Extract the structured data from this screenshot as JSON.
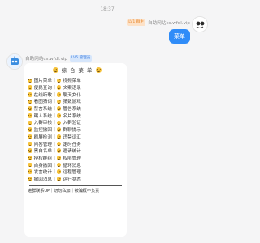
{
  "timestamp": "18:37",
  "outgoing": {
    "level_badge": "LV1 群主",
    "sender_name": "自助网站cs.wfdl.vip",
    "message": "菜单"
  },
  "incoming": {
    "sender_name": "自助网站cs.wfdl.vip",
    "badge": "LV5 管理员",
    "menu_title": "综 合 菜 单",
    "rows": [
      {
        "left": "图片菜单",
        "right": "视频菜单"
      },
      {
        "left": "便民查询",
        "right": "文案语录"
      },
      {
        "left": "在线听歌",
        "right": "聊天女仆"
      },
      {
        "left": "看图猜词",
        "right": "猜数游戏"
      },
      {
        "left": "禁言系统",
        "right": "管告系统"
      },
      {
        "left": "踢人系统",
        "right": "名片系统"
      },
      {
        "left": "入群审核",
        "right": "入群验证"
      },
      {
        "left": "监控撤回",
        "right": "群聊提示"
      },
      {
        "left": "刷屏检测",
        "right": "违禁词汇"
      },
      {
        "left": "问答管理",
        "right": "定时任务"
      },
      {
        "left": "黑白名单",
        "right": "邀请统计"
      },
      {
        "left": "授权群组",
        "right": "权限管理"
      },
      {
        "left": "自身撤回",
        "right": "循环消息"
      },
      {
        "left": "发言统计",
        "right": "远程管理"
      },
      {
        "left": "撤回消息",
        "right": "运行状态"
      }
    ],
    "footer": "进群联系UP｜切勿私加｜被骗概不负责"
  },
  "colors": {
    "bubble_out": "#2f8cf8",
    "badge_orange": "#e8852a",
    "badge_blue": "#3c7ee0",
    "background": "#f5f5f6"
  }
}
